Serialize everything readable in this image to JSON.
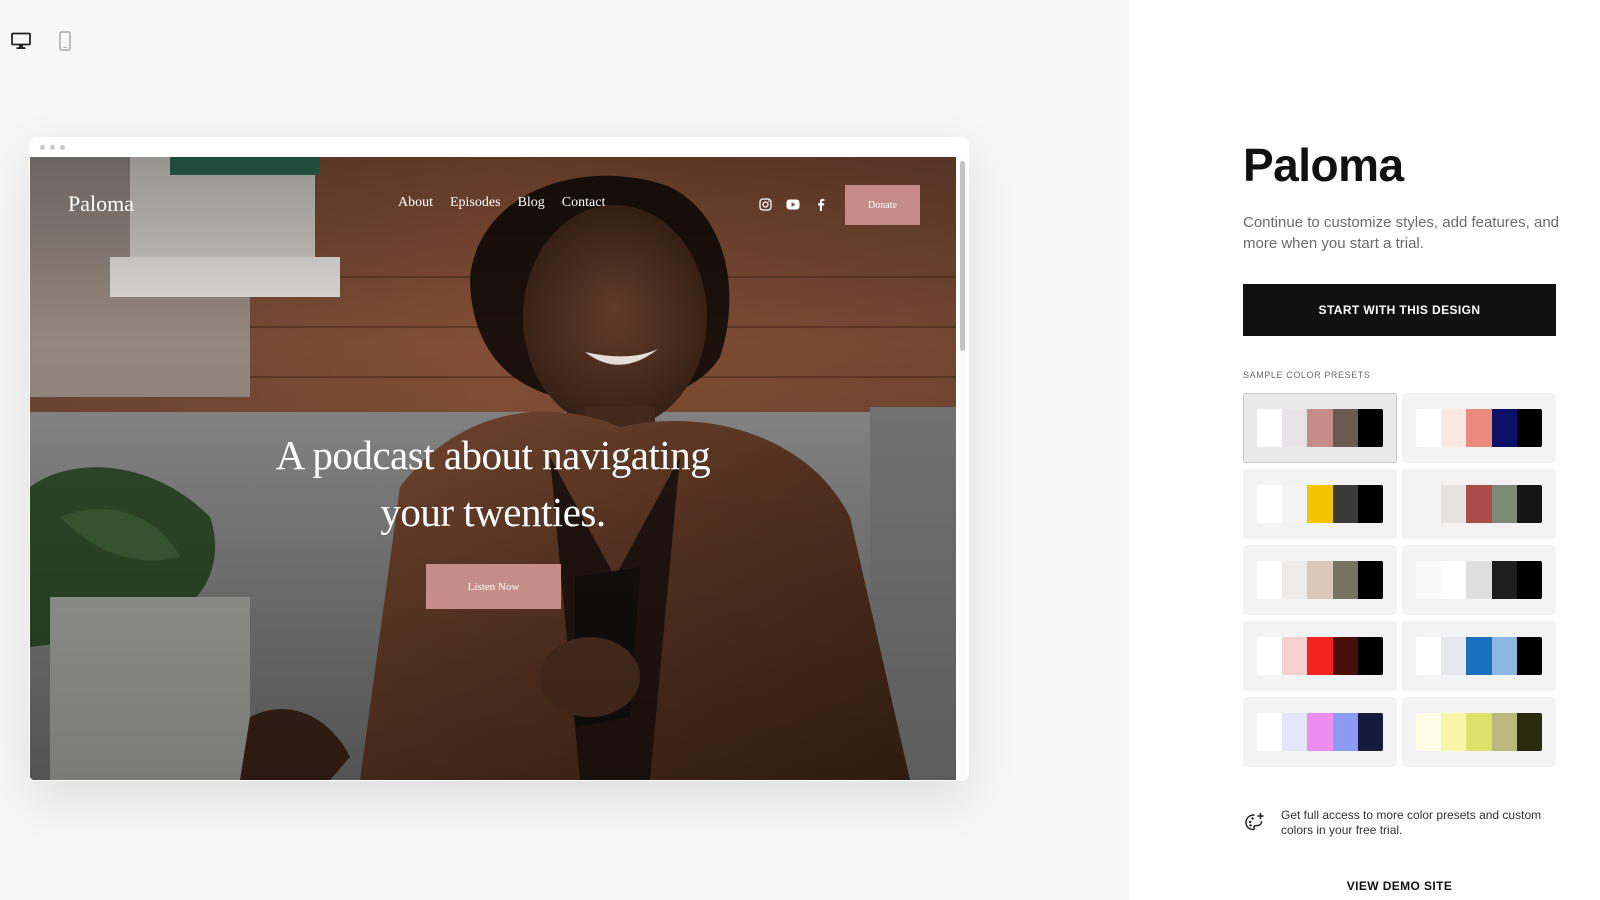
{
  "device_switch": {
    "desktop_icon": "desktop-monitor-icon",
    "mobile_icon": "mobile-phone-icon"
  },
  "site": {
    "logo": "Paloma",
    "nav": [
      "About",
      "Episodes",
      "Blog",
      "Contact"
    ],
    "social_icons": [
      "instagram-icon",
      "youtube-icon",
      "facebook-icon"
    ],
    "donate_label": "Donate",
    "hero_title_line1": "A podcast about navigating",
    "hero_title_line2": "your twenties.",
    "listen_label": "Listen Now",
    "accent_color": "#c58b86"
  },
  "sidebar": {
    "title": "Paloma",
    "description": "Continue to customize styles, add features, and more when you start a trial.",
    "start_button": "START WITH THIS DESIGN",
    "presets_label": "SAMPLE COLOR PRESETS",
    "presets": [
      {
        "selected": true,
        "colors": [
          "#ffffff",
          "#e6e3e6",
          "#c58b86",
          "#6b5a52",
          "#000000"
        ]
      },
      {
        "selected": false,
        "colors": [
          "#ffffff",
          "#fbe8e0",
          "#ec8a80",
          "#10106a",
          "#000000"
        ]
      },
      {
        "selected": false,
        "colors": [
          "#ffffff",
          "#f4f4f4",
          "#f5c400",
          "#3a3a3a",
          "#000000"
        ]
      },
      {
        "selected": false,
        "colors": [
          "#f3f3f3",
          "#e7e2dd",
          "#aa4c4a",
          "#7e8a78",
          "#161616"
        ]
      },
      {
        "selected": false,
        "colors": [
          "#ffffff",
          "#eeece9",
          "#dcc7ba",
          "#767262",
          "#000000"
        ]
      },
      {
        "selected": false,
        "colors": [
          "#fafafa",
          "#ffffff",
          "#dedede",
          "#1f1f1f",
          "#000000"
        ]
      },
      {
        "selected": false,
        "colors": [
          "#ffffff",
          "#f4d0cf",
          "#f4231f",
          "#4a0f0c",
          "#000000"
        ]
      },
      {
        "selected": false,
        "colors": [
          "#ffffff",
          "#e6e7ef",
          "#1a6fbd",
          "#8bb6e1",
          "#000000"
        ]
      },
      {
        "selected": false,
        "colors": [
          "#ffffff",
          "#e5e6fb",
          "#eb8df1",
          "#8b9bf2",
          "#141b3d"
        ]
      },
      {
        "selected": false,
        "colors": [
          "#fdfde8",
          "#f8f7a8",
          "#dde46b",
          "#b9b980",
          "#2a2d0b"
        ]
      }
    ],
    "upsell_icon": "palette-plus-icon",
    "upsell_text": "Get full access to more color presets and custom colors in your free trial.",
    "demo_link": "VIEW DEMO SITE"
  }
}
